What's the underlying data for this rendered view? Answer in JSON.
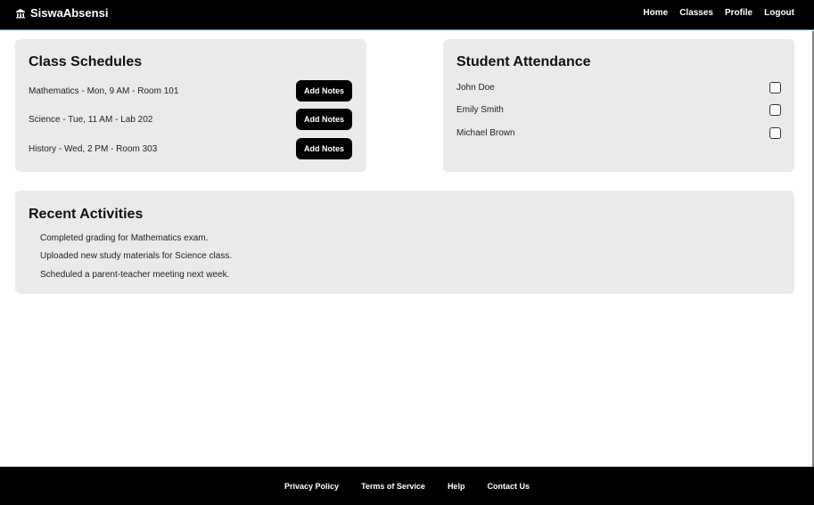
{
  "header": {
    "brand": "SiswaAbsensi",
    "brand_icon": "school-icon",
    "nav": [
      "Home",
      "Classes",
      "Profile",
      "Logout"
    ]
  },
  "schedules": {
    "title": "Class Schedules",
    "button_label": "Add Notes",
    "items": [
      "Mathematics - Mon, 9 AM - Room 101",
      "Science - Tue, 11 AM - Lab 202",
      "History - Wed, 2 PM - Room 303"
    ]
  },
  "attendance": {
    "title": "Student Attendance",
    "students": [
      "John Doe",
      "Emily Smith",
      "Michael Brown"
    ],
    "checked": [
      false,
      false,
      false
    ]
  },
  "activities": {
    "title": "Recent Activities",
    "items": [
      "Completed grading for Mathematics exam.",
      "Uploaded new study materials for Science class.",
      "Scheduled a parent-teacher meeting next week."
    ]
  },
  "footer": {
    "links": [
      "Privacy Policy",
      "Terms of Service",
      "Help",
      "Contact Us"
    ]
  },
  "colors": {
    "nav_bg": "#000000",
    "card_bg": "#eaeaea",
    "button_bg": "#000000",
    "accent_line": "#5b8fd6"
  }
}
